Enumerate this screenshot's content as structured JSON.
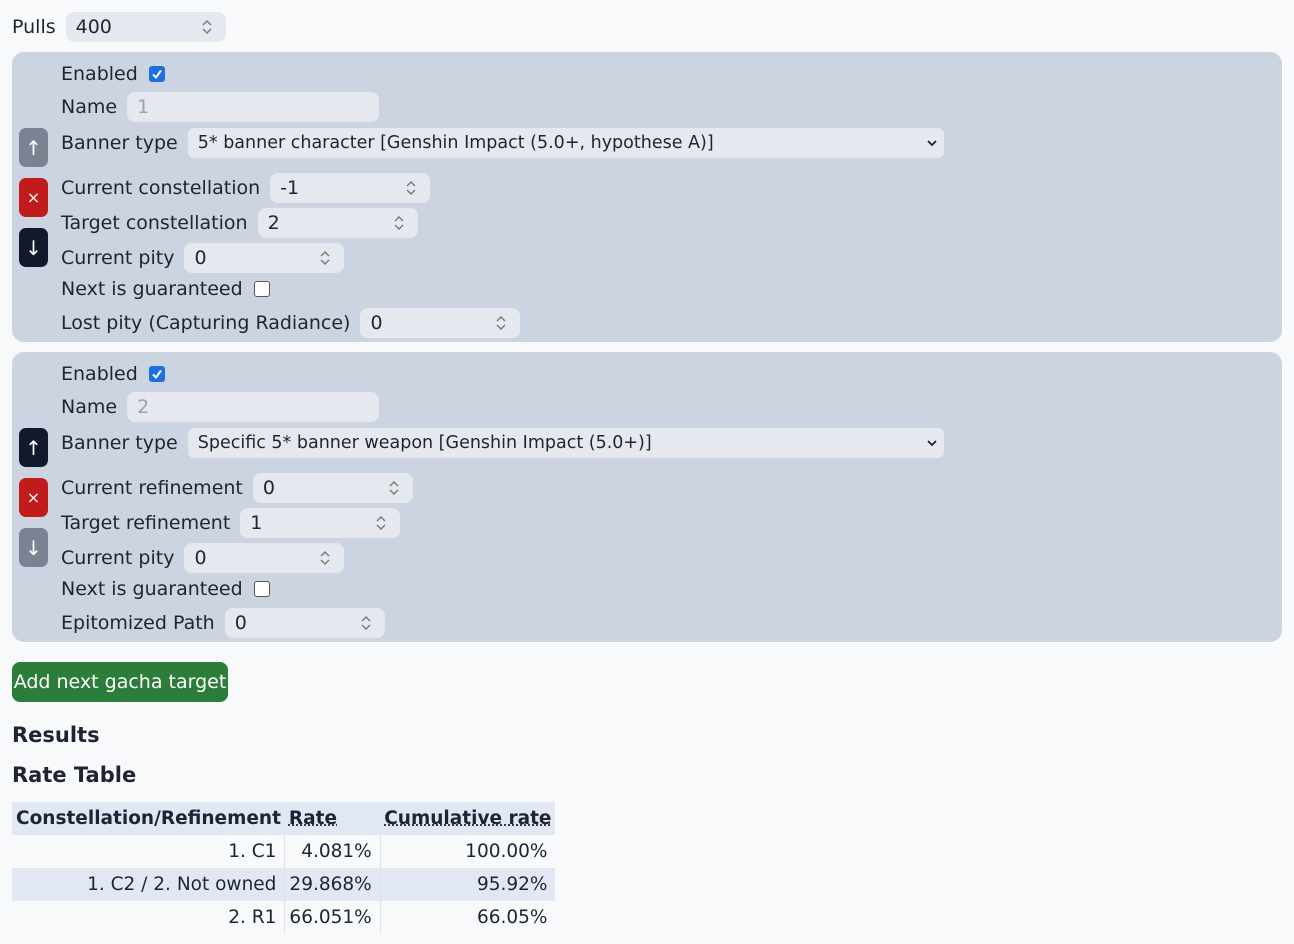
{
  "pulls": {
    "label": "Pulls",
    "value": "400"
  },
  "targets": [
    {
      "enabled_label": "Enabled",
      "name_label": "Name",
      "name_placeholder": "1",
      "banner_type_label": "Banner type",
      "banner_type_value": "5* banner character [Genshin Impact (5.0+, hypothese A)]",
      "current_label": "Current constellation",
      "current_value": "-1",
      "target_label": "Target constellation",
      "target_value": "2",
      "pity_label": "Current pity",
      "pity_value": "0",
      "guaranteed_label": "Next is guaranteed",
      "extra_label": "Lost pity (Capturing Radiance)",
      "extra_value": "0",
      "up_icon": "↑",
      "remove_icon": "×",
      "down_icon": "↓"
    },
    {
      "enabled_label": "Enabled",
      "name_label": "Name",
      "name_placeholder": "2",
      "banner_type_label": "Banner type",
      "banner_type_value": "Specific 5* banner weapon [Genshin Impact (5.0+)]",
      "current_label": "Current refinement",
      "current_value": "0",
      "target_label": "Target refinement",
      "target_value": "1",
      "pity_label": "Current pity",
      "pity_value": "0",
      "guaranteed_label": "Next is guaranteed",
      "extra_label": "Epitomized Path",
      "extra_value": "0",
      "up_icon": "↑",
      "remove_icon": "×",
      "down_icon": "↓"
    }
  ],
  "add_button": "Add next gacha target",
  "results_heading": "Results",
  "rate_table_heading": "Rate Table",
  "table": {
    "headers": [
      "Constellation/Refinement",
      "Rate",
      "Cumulative rate"
    ],
    "rows": [
      [
        "1. C1",
        "4.081%",
        "100.00%"
      ],
      [
        "1. C2 / 2. Not owned",
        "29.868%",
        "95.92%"
      ],
      [
        "2. R1",
        "66.051%",
        "66.05%"
      ]
    ]
  },
  "colors": {
    "panel": "#cbd4e0",
    "add_button": "#2d7d3a",
    "remove_button": "#c21b1b",
    "checkbox": "#1e6fe0"
  }
}
